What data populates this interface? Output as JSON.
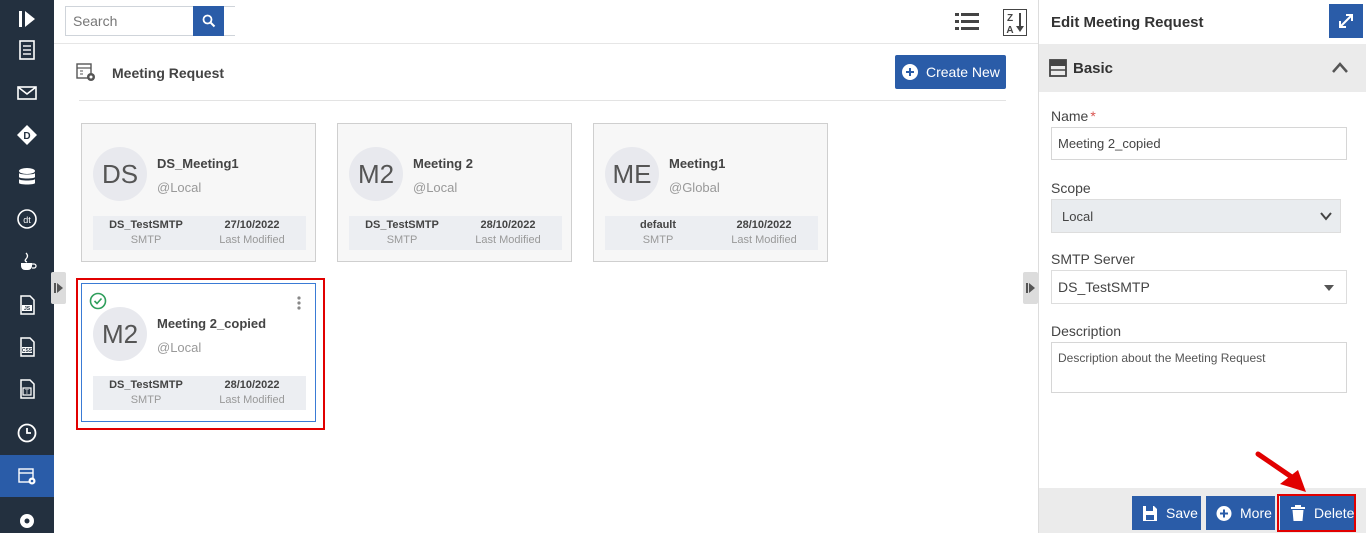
{
  "toolbar": {
    "search_placeholder": "Search"
  },
  "page": {
    "title": "Meeting Request",
    "create_label": "Create New"
  },
  "cards": [
    {
      "initials": "DS",
      "name": "DS_Meeting1",
      "scope": "@Local",
      "server": "DS_TestSMTP",
      "server_label": "SMTP",
      "date": "27/10/2022",
      "date_label": "Last Modified"
    },
    {
      "initials": "M2",
      "name": "Meeting 2",
      "scope": "@Local",
      "server": "DS_TestSMTP",
      "server_label": "SMTP",
      "date": "28/10/2022",
      "date_label": "Last Modified"
    },
    {
      "initials": "ME",
      "name": "Meeting1",
      "scope": "@Global",
      "server": "default",
      "server_label": "SMTP",
      "date": "28/10/2022",
      "date_label": "Last Modified"
    },
    {
      "initials": "M2",
      "name": "Meeting 2_copied",
      "scope": "@Local",
      "server": "DS_TestSMTP",
      "server_label": "SMTP",
      "date": "28/10/2022",
      "date_label": "Last Modified"
    }
  ],
  "panel": {
    "title": "Edit Meeting Request",
    "section": "Basic",
    "name_label": "Name",
    "required_mark": "*",
    "name_value": "Meeting 2_copied",
    "scope_label": "Scope",
    "scope_value": "Local",
    "smtp_label": "SMTP Server",
    "smtp_value": "DS_TestSMTP",
    "description_label": "Description",
    "description_value": "Description about the Meeting Request",
    "save_label": "Save",
    "more_label": "More",
    "delete_label": "Delete"
  },
  "colors": {
    "accent": "#2a5ca8",
    "rail": "#23303f",
    "highlight": "#e10000",
    "selected_check": "#2e9e5b"
  }
}
